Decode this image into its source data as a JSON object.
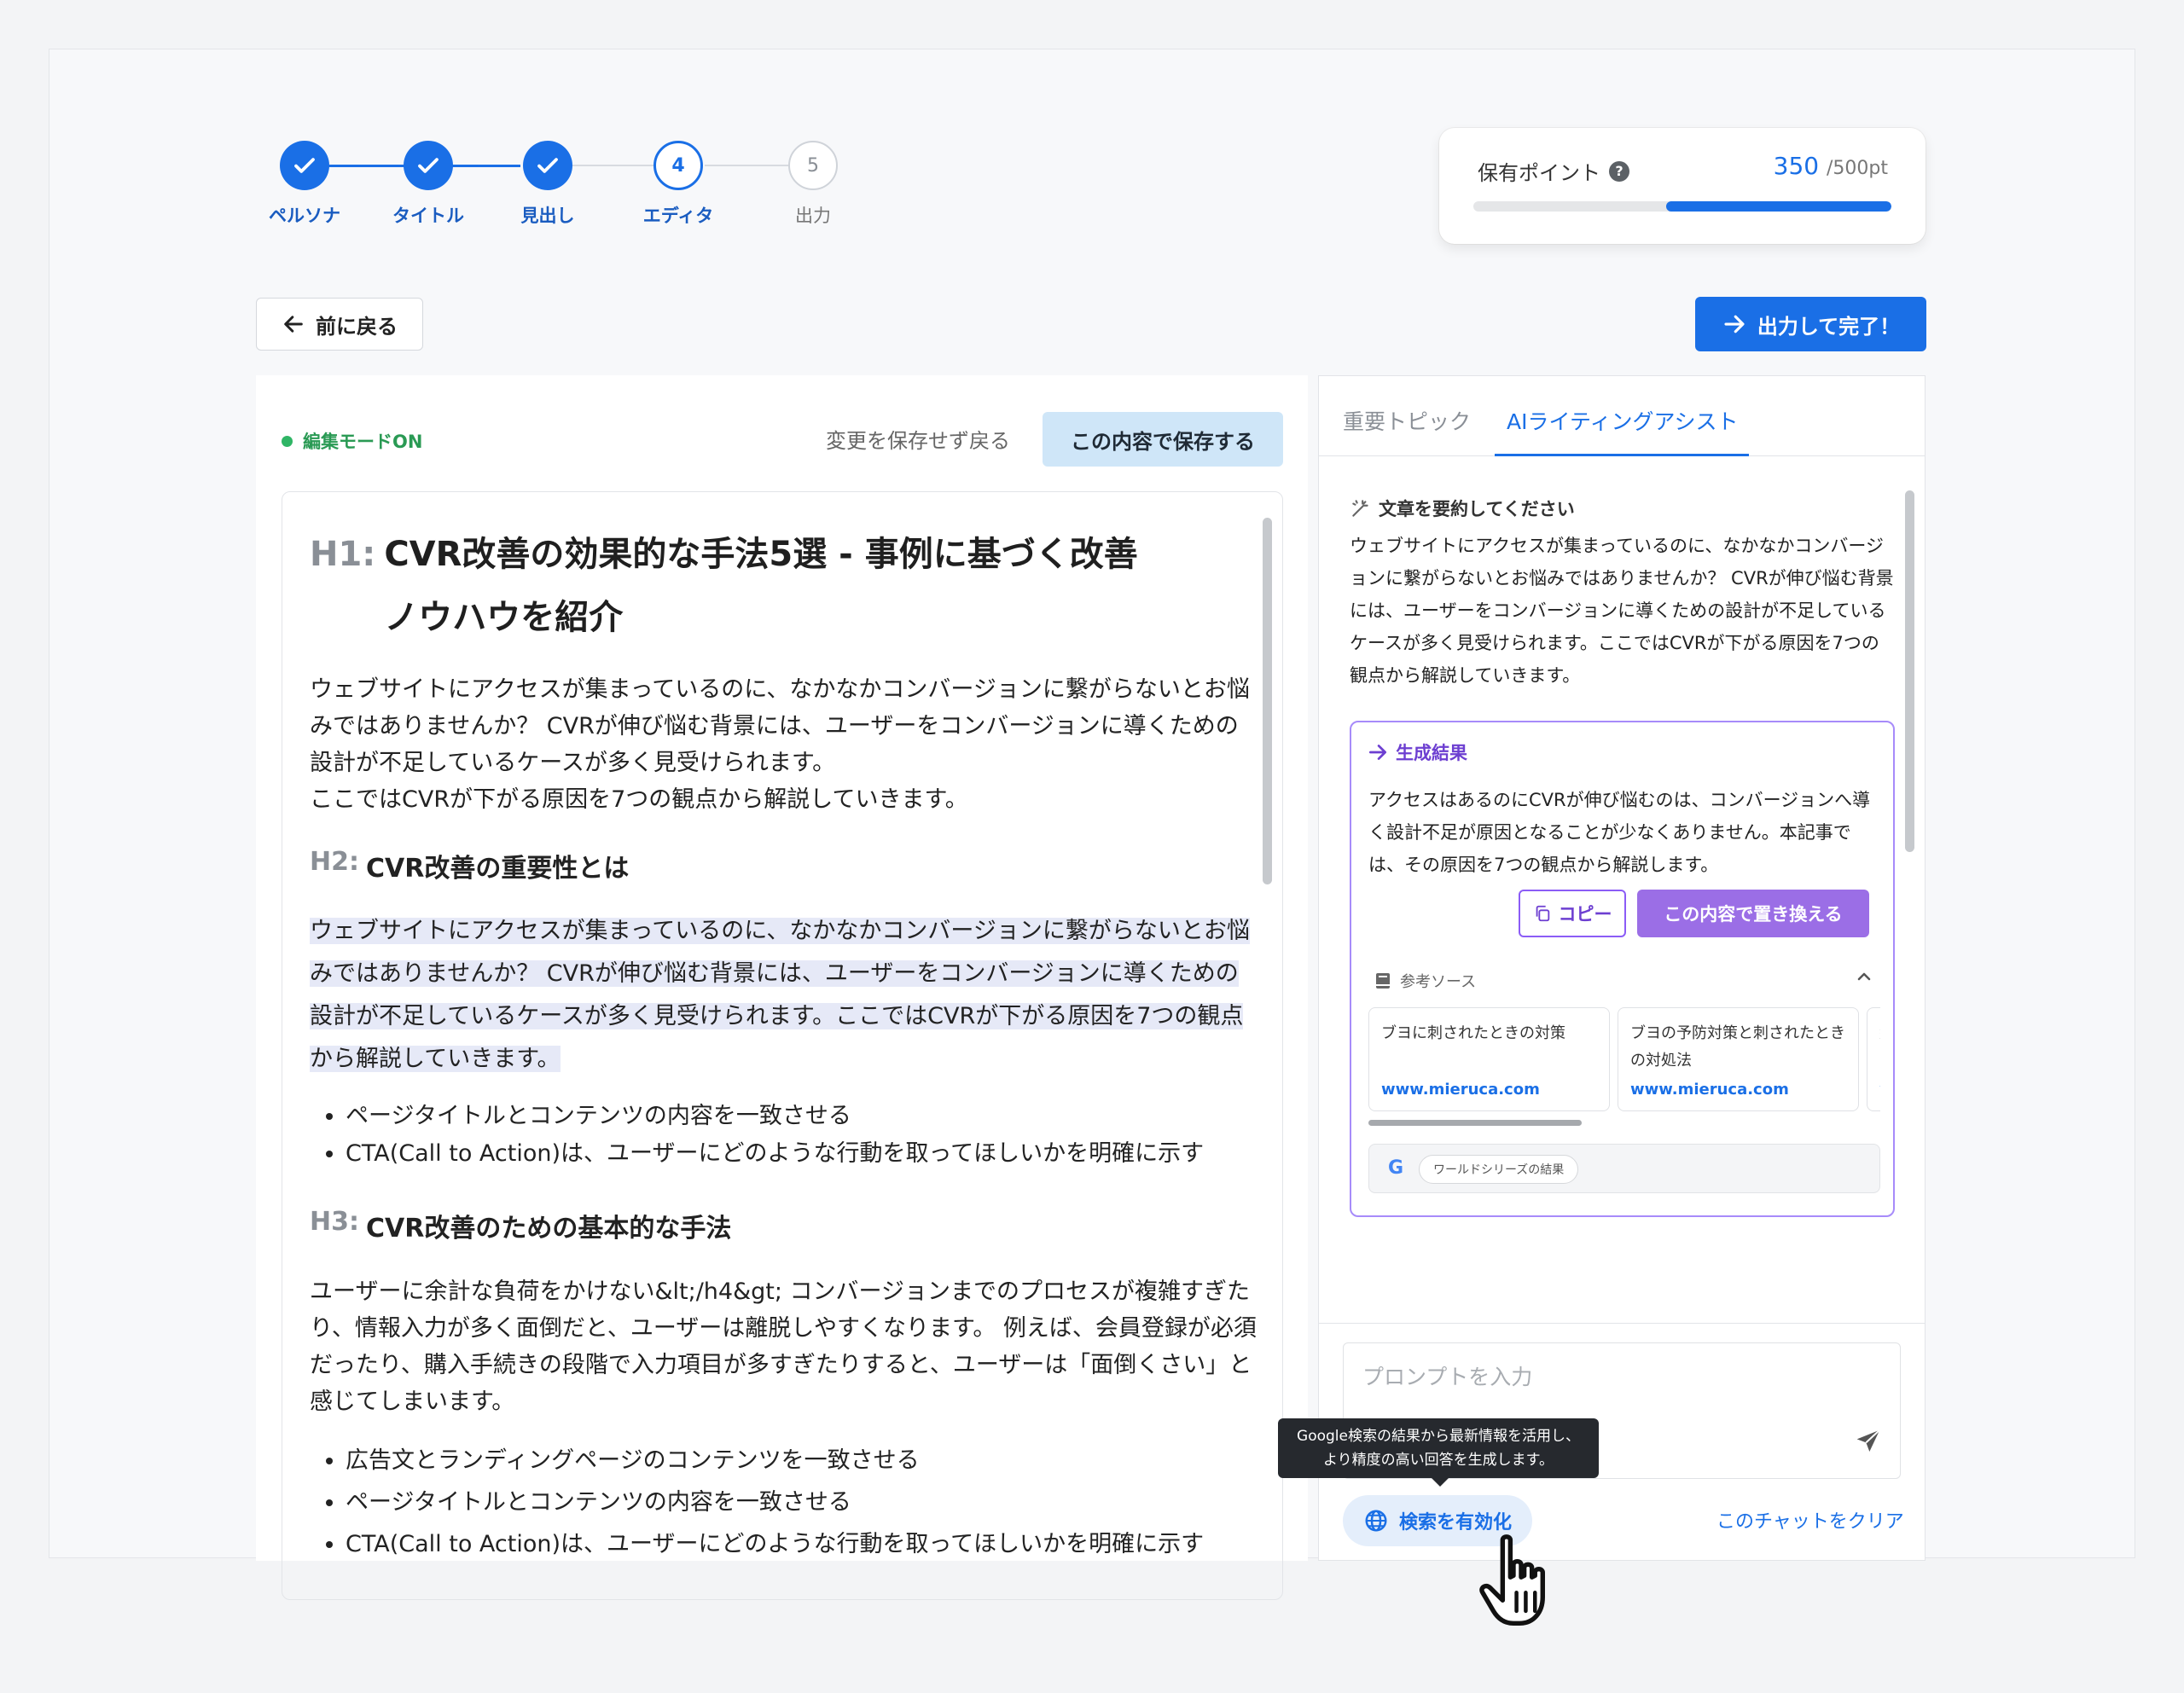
{
  "stepper": {
    "steps": [
      {
        "label": "ペルソナ",
        "state": "done",
        "mark": "✓"
      },
      {
        "label": "タイトル",
        "state": "done",
        "mark": "✓"
      },
      {
        "label": "見出し",
        "state": "done",
        "mark": "✓"
      },
      {
        "label": "エディタ",
        "state": "current",
        "mark": "4"
      },
      {
        "label": "出力",
        "state": "todo",
        "mark": "5"
      }
    ]
  },
  "points": {
    "title": "保有ポイント",
    "help_icon": "?",
    "value": "350",
    "max": "/500pt",
    "fill_fraction": 0.7
  },
  "nav": {
    "back_label": "前に戻る",
    "finish_label": "出力して完了！"
  },
  "editor": {
    "mode_label": "編集モードON",
    "discard_label": "変更を保存せず戻る",
    "save_label": "この内容で保存する",
    "h1_tag": "H1:",
    "h1_text": "CVR改善の効果的な手法5選 - 事例に基づく改善ノウハウを紹介",
    "intro": "ウェブサイトにアクセスが集まっているのに、なかなかコンバージョンに繋がらないとお悩みではありませんか？ CVRが伸び悩む背景には、ユーザーをコンバージョンに導くための設計が不足しているケースが多く見受けられます。",
    "intro2": "ここではCVRが下がる原因を7つの観点から解説していきます。",
    "h2_tag": "H2:",
    "h2_text": "CVR改善の重要性とは",
    "highlight": "ウェブサイトにアクセスが集まっているのに、なかなかコンバージョンに繋がらないとお悩みではありませんか？ CVRが伸び悩む背景には、ユーザーをコンバージョンに導くための設計が不足しているケースが多く見受けられます。ここではCVRが下がる原因を7つの観点から解説していきます。",
    "list1": [
      "ページタイトルとコンテンツの内容を一致させる",
      "CTA(Call to Action)は、ユーザーにどのような行動を取ってほしいかを明確に示す"
    ],
    "h3_tag": "H3:",
    "h3_text": "CVR改善のための基本的な手法",
    "para3": "ユーザーに余計な負荷をかけない&lt;/h4&gt; コンバージョンまでのプロセスが複雑すぎたり、情報入力が多く面倒だと、ユーザーは離脱しやすくなります。 例えば、会員登録が必須だったり、購入手続きの段階で入力項目が多すぎたりすると、ユーザーは「面倒くさい」と感じてしまいます。",
    "list2": [
      "広告文とランディングページのコンテンツを一致させる",
      "ページタイトルとコンテンツの内容を一致させる",
      "CTA(Call to Action)は、ユーザーにどのような行動を取ってほしいかを明確に示す"
    ]
  },
  "panel": {
    "tabs": [
      "重要トピック",
      "AIライティングアシスト"
    ],
    "summary_title": "文章を要約してください",
    "summary_text": "ウェブサイトにアクセスが集まっているのに、なかなかコンバージョンに繋がらないとお悩みではありませんか？ CVRが伸び悩む背景には、ユーザーをコンバージョンに導くための設計が不足しているケースが多く見受けられます。ここではCVRが下がる原因を7つの観点から解説していきます。",
    "result_title": "生成結果",
    "result_text": "アクセスはあるのにCVRが伸び悩むのは、コンバージョンへ導く設計不足が原因となることが少なくありません。本記事では、その原因を7つの観点から解説します。",
    "copy_label": "コピー",
    "replace_label": "この内容で置き換える",
    "sources_label": "参考ソース",
    "sources": [
      {
        "title": "ブヨに刺されたときの対策",
        "url": "www.mieruca.com"
      },
      {
        "title": "ブヨの予防対策と刺されたときの対処法",
        "url": "www.mieruca.com"
      },
      {
        "title": "紀",
        "url": "w"
      }
    ],
    "google_chip": "ワールドシリーズの結果",
    "prompt_placeholder": "プロンプトを入力",
    "clear_label": "このチャットをクリア",
    "search_label": "検索を有効化",
    "tooltip_line1": "Google検索の結果から最新情報を活用し、",
    "tooltip_line2": "より精度の高い回答を生成します。"
  }
}
